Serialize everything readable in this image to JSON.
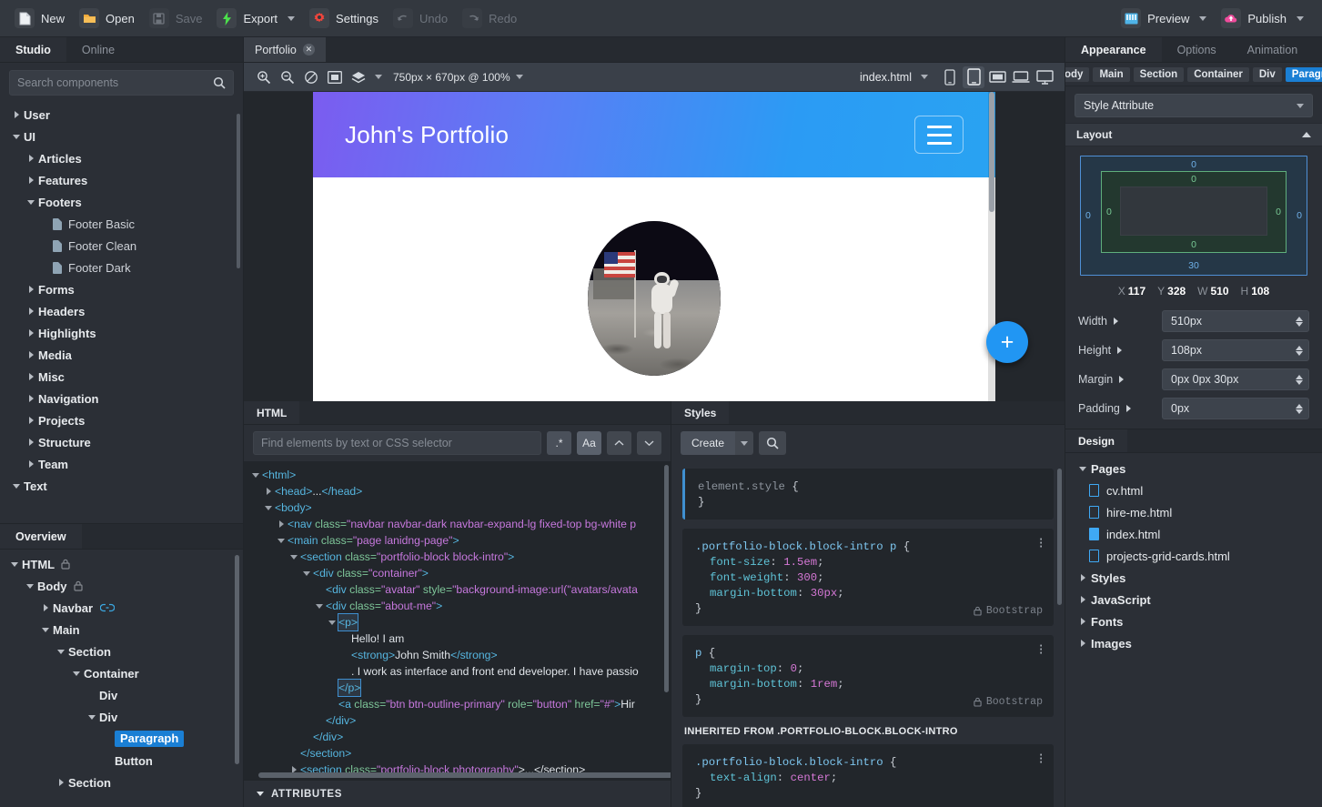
{
  "toolbar": {
    "items": [
      {
        "label": "New",
        "icon": "new-document-icon",
        "disabled": false,
        "dropdown": false
      },
      {
        "label": "Open",
        "icon": "open-folder-icon",
        "disabled": false,
        "dropdown": false
      },
      {
        "label": "Save",
        "icon": "save-disk-icon",
        "disabled": true,
        "dropdown": false
      },
      {
        "label": "Export",
        "icon": "export-bolt-icon",
        "disabled": false,
        "dropdown": true
      },
      {
        "label": "Settings",
        "icon": "settings-gear-icon",
        "disabled": false,
        "dropdown": false
      },
      {
        "label": "Undo",
        "icon": "undo-arrow-icon",
        "disabled": true,
        "dropdown": false
      },
      {
        "label": "Redo",
        "icon": "redo-arrow-icon",
        "disabled": true,
        "dropdown": false
      }
    ],
    "right_items": [
      {
        "label": "Preview",
        "icon": "preview-monitor-icon",
        "dropdown": true
      },
      {
        "label": "Publish",
        "icon": "publish-cloud-icon",
        "dropdown": true
      }
    ]
  },
  "left_panel": {
    "tabs": [
      {
        "label": "Studio",
        "active": true
      },
      {
        "label": "Online",
        "active": false
      }
    ],
    "search": {
      "placeholder": "Search components",
      "value": "",
      "icon": "search-icon"
    },
    "components": [
      {
        "label": "User",
        "depth": 0,
        "state": "collapsed"
      },
      {
        "label": "UI",
        "depth": 0,
        "state": "expanded"
      },
      {
        "label": "Articles",
        "depth": 1,
        "state": "collapsed"
      },
      {
        "label": "Features",
        "depth": 1,
        "state": "collapsed"
      },
      {
        "label": "Footers",
        "depth": 1,
        "state": "expanded"
      },
      {
        "label": "Footer Basic",
        "depth": 2,
        "state": "leaf"
      },
      {
        "label": "Footer Clean",
        "depth": 2,
        "state": "leaf"
      },
      {
        "label": "Footer Dark",
        "depth": 2,
        "state": "leaf"
      },
      {
        "label": "Forms",
        "depth": 1,
        "state": "collapsed"
      },
      {
        "label": "Headers",
        "depth": 1,
        "state": "collapsed"
      },
      {
        "label": "Highlights",
        "depth": 1,
        "state": "collapsed"
      },
      {
        "label": "Media",
        "depth": 1,
        "state": "collapsed"
      },
      {
        "label": "Misc",
        "depth": 1,
        "state": "collapsed"
      },
      {
        "label": "Navigation",
        "depth": 1,
        "state": "collapsed"
      },
      {
        "label": "Projects",
        "depth": 1,
        "state": "collapsed"
      },
      {
        "label": "Structure",
        "depth": 1,
        "state": "collapsed"
      },
      {
        "label": "Team",
        "depth": 1,
        "state": "collapsed"
      },
      {
        "label": "Text",
        "depth": 0,
        "state": "expanded"
      }
    ]
  },
  "overview": {
    "tab_label": "Overview",
    "nodes": [
      {
        "label": "HTML",
        "depth": 0,
        "state": "expanded",
        "badge": "lock"
      },
      {
        "label": "Body",
        "depth": 1,
        "state": "expanded",
        "badge": "lock"
      },
      {
        "label": "Navbar",
        "depth": 2,
        "state": "collapsed",
        "badge": "link"
      },
      {
        "label": "Main",
        "depth": 2,
        "state": "expanded",
        "badge": ""
      },
      {
        "label": "Section",
        "depth": 3,
        "state": "expanded",
        "badge": ""
      },
      {
        "label": "Container",
        "depth": 4,
        "state": "expanded",
        "badge": ""
      },
      {
        "label": "Div",
        "depth": 5,
        "state": "leaf",
        "badge": ""
      },
      {
        "label": "Div",
        "depth": 5,
        "state": "expanded",
        "badge": ""
      },
      {
        "label": "Paragraph",
        "depth": 6,
        "state": "leaf",
        "badge": "",
        "selected": true
      },
      {
        "label": "Button",
        "depth": 6,
        "state": "leaf",
        "badge": ""
      },
      {
        "label": "Section",
        "depth": 3,
        "state": "collapsed",
        "badge": ""
      }
    ]
  },
  "center": {
    "document_tab": {
      "label": "Portfolio",
      "close_icon": "close-icon"
    },
    "canvas_toolbar": {
      "zoom_in_icon": "zoom-in-icon",
      "zoom_out_icon": "zoom-out-icon",
      "contrast_icon": "contrast-icon",
      "fit_icon": "fit-to-screen-icon",
      "layers_icon": "layers-icon",
      "size_label": "750px × 670px @ 100%",
      "file_label": "index.html",
      "devices": [
        {
          "name": "device-phone",
          "active": false
        },
        {
          "name": "device-tablet",
          "active": true
        },
        {
          "name": "device-small-desktop",
          "active": false
        },
        {
          "name": "device-laptop",
          "active": false
        },
        {
          "name": "device-desktop",
          "active": false
        }
      ]
    },
    "preview": {
      "brand": "John's Portfolio",
      "menu_icon": "hamburger-menu-icon",
      "avatar_alt": "astronaut-on-the-moon-avatar",
      "fab_label": "+"
    }
  },
  "html_pane": {
    "tab_label": "HTML",
    "find": {
      "placeholder": "Find elements by text or CSS selector",
      "value": ""
    },
    "buttons": [
      {
        "label": ".*",
        "name": "regex-toggle"
      },
      {
        "label": "Aa",
        "name": "match-case-toggle"
      },
      {
        "label": "^",
        "name": "find-previous-button"
      },
      {
        "label": "v",
        "name": "find-next-button"
      }
    ],
    "lines": [
      {
        "indent": 0,
        "tw": "down",
        "parts": [
          {
            "t": "tag",
            "v": "<html>"
          }
        ]
      },
      {
        "indent": 1,
        "tw": "right",
        "parts": [
          {
            "t": "tag",
            "v": "<head>"
          },
          {
            "t": "txt",
            "v": "..."
          },
          {
            "t": "tag",
            "v": "</head>"
          }
        ]
      },
      {
        "indent": 1,
        "tw": "down",
        "parts": [
          {
            "t": "tag",
            "v": "<body>"
          }
        ]
      },
      {
        "indent": 2,
        "tw": "right",
        "parts": [
          {
            "t": "tag",
            "v": "<nav "
          },
          {
            "t": "attr",
            "v": "class="
          },
          {
            "t": "val",
            "v": "\"navbar navbar-dark navbar-expand-lg fixed-top bg-white p"
          }
        ]
      },
      {
        "indent": 2,
        "tw": "down",
        "parts": [
          {
            "t": "tag",
            "v": "<main "
          },
          {
            "t": "attr",
            "v": "class="
          },
          {
            "t": "val",
            "v": "\"page lanidng-page\""
          },
          {
            "t": "tag",
            "v": ">"
          }
        ]
      },
      {
        "indent": 3,
        "tw": "down",
        "parts": [
          {
            "t": "tag",
            "v": "<section "
          },
          {
            "t": "attr",
            "v": "class="
          },
          {
            "t": "val",
            "v": "\"portfolio-block block-intro\""
          },
          {
            "t": "tag",
            "v": ">"
          }
        ]
      },
      {
        "indent": 4,
        "tw": "down",
        "parts": [
          {
            "t": "tag",
            "v": "<div "
          },
          {
            "t": "attr",
            "v": "class="
          },
          {
            "t": "val",
            "v": "\"container\""
          },
          {
            "t": "tag",
            "v": ">"
          }
        ]
      },
      {
        "indent": 5,
        "tw": "none",
        "parts": [
          {
            "t": "tag",
            "v": "<div "
          },
          {
            "t": "attr",
            "v": "class="
          },
          {
            "t": "val",
            "v": "\"avatar\""
          },
          {
            "t": "attr",
            "v": " style="
          },
          {
            "t": "val",
            "v": "\"background-image:url(\"avatars/avata"
          }
        ]
      },
      {
        "indent": 5,
        "tw": "down",
        "parts": [
          {
            "t": "tag",
            "v": "<div "
          },
          {
            "t": "attr",
            "v": "class="
          },
          {
            "t": "val",
            "v": "\"about-me\""
          },
          {
            "t": "tag",
            "v": ">"
          }
        ]
      },
      {
        "indent": 6,
        "tw": "down",
        "sel": true,
        "parts": [
          {
            "t": "tag",
            "v": "<p>"
          }
        ]
      },
      {
        "indent": 7,
        "tw": "none",
        "parts": [
          {
            "t": "txt",
            "v": "Hello! I am"
          }
        ]
      },
      {
        "indent": 7,
        "tw": "none",
        "parts": [
          {
            "t": "tag",
            "v": "<strong>"
          },
          {
            "t": "txt",
            "v": "John Smith"
          },
          {
            "t": "tag",
            "v": "</strong>"
          }
        ]
      },
      {
        "indent": 7,
        "tw": "none",
        "parts": [
          {
            "t": "txt",
            "v": ". I work as interface and front end developer. I have passio"
          }
        ]
      },
      {
        "indent": 6,
        "tw": "none",
        "sel": true,
        "parts": [
          {
            "t": "tag",
            "v": "</p>"
          }
        ]
      },
      {
        "indent": 6,
        "tw": "none",
        "parts": [
          {
            "t": "tag",
            "v": "<a "
          },
          {
            "t": "attr",
            "v": "class="
          },
          {
            "t": "val",
            "v": "\"btn btn-outline-primary\""
          },
          {
            "t": "attr",
            "v": " role="
          },
          {
            "t": "val",
            "v": "\"button\""
          },
          {
            "t": "attr",
            "v": " href="
          },
          {
            "t": "val",
            "v": "\"#\""
          },
          {
            "t": "tag",
            "v": ">"
          },
          {
            "t": "txt",
            "v": "Hir"
          }
        ]
      },
      {
        "indent": 5,
        "tw": "none",
        "parts": [
          {
            "t": "tag",
            "v": "</div>"
          }
        ]
      },
      {
        "indent": 4,
        "tw": "none",
        "parts": [
          {
            "t": "tag",
            "v": "</div>"
          }
        ]
      },
      {
        "indent": 3,
        "tw": "none",
        "parts": [
          {
            "t": "tag",
            "v": "</section>"
          }
        ]
      },
      {
        "indent": 3,
        "tw": "right",
        "parts": [
          {
            "t": "tag",
            "v": "<section "
          },
          {
            "t": "attr",
            "v": "class="
          },
          {
            "t": "val",
            "v": "\"portfolio-block photography\""
          },
          {
            "t": "txt",
            "v": ">...</section>"
          }
        ]
      }
    ],
    "attributes_label": "ATTRIBUTES"
  },
  "styles_pane": {
    "tab_label": "Styles",
    "create_label": "Create",
    "search_icon": "search-icon",
    "rules": [
      {
        "selector": "element.style",
        "declarations": [],
        "muted": true,
        "origin": ""
      },
      {
        "selector": ".portfolio-block.block-intro p",
        "declarations": [
          {
            "prop": "font-size",
            "value": "1.5em"
          },
          {
            "prop": "font-weight",
            "value": "300"
          },
          {
            "prop": "margin-bottom",
            "value": "30px"
          }
        ],
        "muted": false,
        "origin": "Bootstrap"
      },
      {
        "selector": "p",
        "declarations": [
          {
            "prop": "margin-top",
            "value": "0"
          },
          {
            "prop": "margin-bottom",
            "value": "1rem"
          }
        ],
        "muted": false,
        "origin": "Bootstrap"
      }
    ],
    "inherited_header": "INHERITED FROM .PORTFOLIO-BLOCK.BLOCK-INTRO",
    "inherited_rules": [
      {
        "selector": ".portfolio-block.block-intro",
        "declarations": [
          {
            "prop": "text-align",
            "value": "center"
          }
        ],
        "muted": false,
        "origin": ""
      }
    ]
  },
  "right_panel": {
    "tabs": [
      {
        "label": "Appearance",
        "active": true
      },
      {
        "label": "Options",
        "active": false
      },
      {
        "label": "Animation",
        "active": false
      }
    ],
    "breadcrumb": [
      "ody",
      "Main",
      "Section",
      "Container",
      "Div",
      "Paragraph"
    ],
    "breadcrumb_active": "Paragraph",
    "style_attribute_label": "Style Attribute",
    "layout_label": "Layout",
    "box_model": {
      "margin": {
        "top": "0",
        "right": "0",
        "bottom": "30",
        "left": "0"
      },
      "padding": {
        "top": "0",
        "right": "0",
        "bottom": "0",
        "left": "0"
      }
    },
    "dims": [
      {
        "key": "X",
        "value": "117"
      },
      {
        "key": "Y",
        "value": "328"
      },
      {
        "key": "W",
        "value": "510"
      },
      {
        "key": "H",
        "value": "108"
      }
    ],
    "properties": [
      {
        "label": "Width",
        "value": "510px"
      },
      {
        "label": "Height",
        "value": "108px"
      },
      {
        "label": "Margin",
        "value": "0px 0px 30px"
      },
      {
        "label": "Padding",
        "value": "0px"
      }
    ],
    "design": {
      "tab_label": "Design",
      "nodes": [
        {
          "label": "Pages",
          "type": "group",
          "state": "expanded"
        },
        {
          "label": "cv.html",
          "type": "file",
          "selected": false
        },
        {
          "label": "hire-me.html",
          "type": "file",
          "selected": false
        },
        {
          "label": "index.html",
          "type": "file",
          "selected": true
        },
        {
          "label": "projects-grid-cards.html",
          "type": "file",
          "selected": false
        },
        {
          "label": "Styles",
          "type": "group",
          "state": "collapsed"
        },
        {
          "label": "JavaScript",
          "type": "group",
          "state": "collapsed"
        },
        {
          "label": "Fonts",
          "type": "group",
          "state": "collapsed"
        },
        {
          "label": "Images",
          "type": "group",
          "state": "collapsed"
        }
      ]
    }
  },
  "colors": {
    "accent": "#1a7fd4",
    "fab": "#2196f3",
    "nav_gradient_from": "#7b5cf0",
    "nav_gradient_to": "#29a3f2"
  }
}
